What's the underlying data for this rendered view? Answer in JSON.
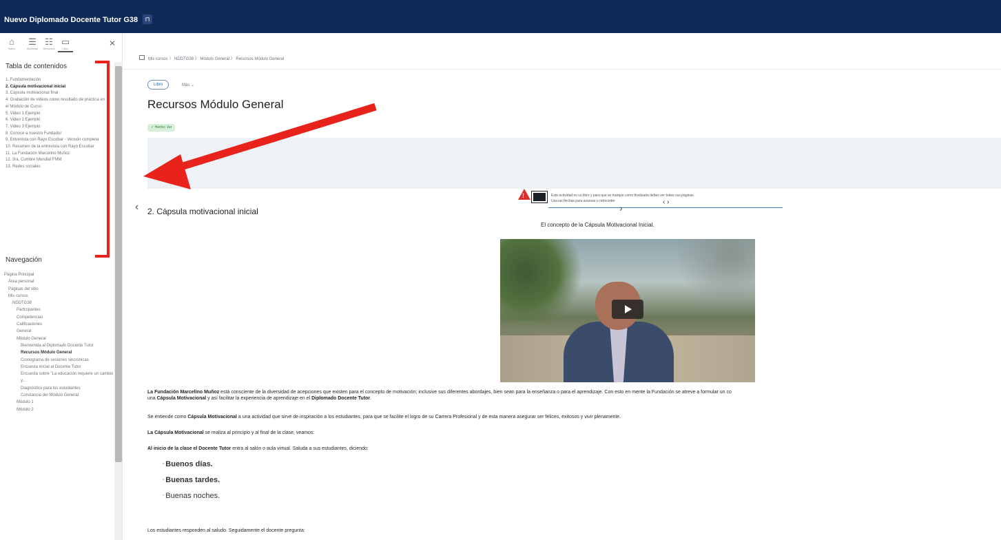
{
  "topbar": {
    "title": "Nuevo Diplomado Docente Tutor G38",
    "pin_icon": "pin-icon"
  },
  "drawer": {
    "close": "✕",
    "tools": [
      "Índice",
      "Actividad",
      "Recursos",
      "Libro"
    ],
    "toc_heading": "Tabla de contenidos",
    "toc_items": [
      "1. Fundamentación",
      "2. Cápsula motivacional inicial",
      "3. Cápsula motivacional final",
      "4. Grabación de vídeos como resultado de práctica en el Módulo de Curso",
      "5. Video 1 Ejemplo",
      "6. Video 2 Ejemplo",
      "7. Video 3 Ejemplo",
      "8. Conoce a nuestro Fundador",
      "9. Entrevista con Rayo Escobar - Versión completa",
      "10. Resumen de la entrevista con Rayo Escobar",
      "11. La Fundación Marcelino Muñoz",
      "12. 3ra. Cumbre Mundial FMM",
      "13. Redes sociales"
    ],
    "toc_current_index": 1,
    "nav_heading": "Navegación",
    "nav_items": [
      {
        "label": "Página Principal",
        "bold": false,
        "indent": 0
      },
      {
        "label": "Área personal",
        "bold": false,
        "indent": 1
      },
      {
        "label": "Páginas del sitio",
        "bold": false,
        "indent": 1
      },
      {
        "label": "Mis cursos",
        "bold": false,
        "indent": 1
      },
      {
        "label": "NDDTG38",
        "bold": false,
        "indent": 2
      },
      {
        "label": "Participantes",
        "bold": false,
        "indent": 3
      },
      {
        "label": "Competencias",
        "bold": false,
        "indent": 3
      },
      {
        "label": "Calificaciones",
        "bold": false,
        "indent": 3
      },
      {
        "label": "General",
        "bold": false,
        "indent": 3
      },
      {
        "label": "Módulo General",
        "bold": false,
        "indent": 3
      },
      {
        "label": "Bienvenida al Diplomado Docente Tutor",
        "bold": false,
        "indent": 4
      },
      {
        "label": "Recursos Módulo General",
        "bold": true,
        "indent": 4
      },
      {
        "label": "Cronograma de sesiones sincrónicas",
        "bold": false,
        "indent": 4
      },
      {
        "label": "Encuesta inicial al Docente Tutor",
        "bold": false,
        "indent": 4
      },
      {
        "label": "Encuesta sobre \"La educación requiere un cambio y...",
        "bold": false,
        "indent": 4
      },
      {
        "label": "Diagnóstico para los estudiantes",
        "bold": false,
        "indent": 4
      },
      {
        "label": "Constancia del Módulo General",
        "bold": false,
        "indent": 4
      },
      {
        "label": "Módulo 1",
        "bold": false,
        "indent": 3
      },
      {
        "label": "Módulo 2",
        "bold": false,
        "indent": 3
      }
    ]
  },
  "breadcrumb": "Mis cursos  〉 NDDTG38  〉 Módulo General  〉 Recursos Módulo General",
  "tabs": {
    "libro": "Libro",
    "mas": "Más ⌄"
  },
  "page_title": "Recursos Módulo General",
  "badge": "✓ Hecho: Ver",
  "notice": {
    "line1": "Esta actividad es un libro y para que se marque como finalizada debes ver todas sus páginas.",
    "line2": "Usa las flechas para avanzar o retroceder",
    "nav": "‹  ›"
  },
  "chapter": {
    "prev": "‹",
    "next": "›",
    "title": "2. Cápsula motivacional inicial",
    "subheading": "El concepto de la Cápsula Motivacional Inicial."
  },
  "body": {
    "p1_bold_a": "La Fundación Marcelino Muñoz",
    "p1_a": " está consciente de la diversidad de acepciones que existen para el concepto de motivación; inclusive sus diferentes abordajes, bien sean para la enseñanza o para el aprendizaje.  Con esto en mente la Fundación se atreve a formular un co",
    "p1_b": "una ",
    "p1_bold_b": "Cápsula Motivacional",
    "p1_c": " y así facilitar la experiencia de aprendizaje en el ",
    "p1_bold_c": "Diplomado Docente Tutor",
    "p1_d": ".",
    "p2_a": "Se entiende como ",
    "p2_bold": "Cápsula Motivacional",
    "p2_b": " a una actividad que sirve de inspiración a los estudiantes, para que se facilite el logro de su Carrera Profesional y de esta manera asegurar ser felices, exitosos y vivir plenamente.",
    "p3_bold": "La Cápsula Motivacional",
    "p3": " se realiza al principio y al final de la clase, veamos:",
    "p4_bold_a": "Al inicio de la clase el Docente Tutor",
    "p4": " entra al salón o aula virtual. Saluda a sus estudiantes, diciendo:",
    "greetings": [
      "Buenos días.",
      "Buenas tardes.",
      "Buenas noches."
    ],
    "p5": "Los estudiantes responden al saludo. Seguidamente el docente pregunta:"
  },
  "annotation_color": "#e8231c"
}
